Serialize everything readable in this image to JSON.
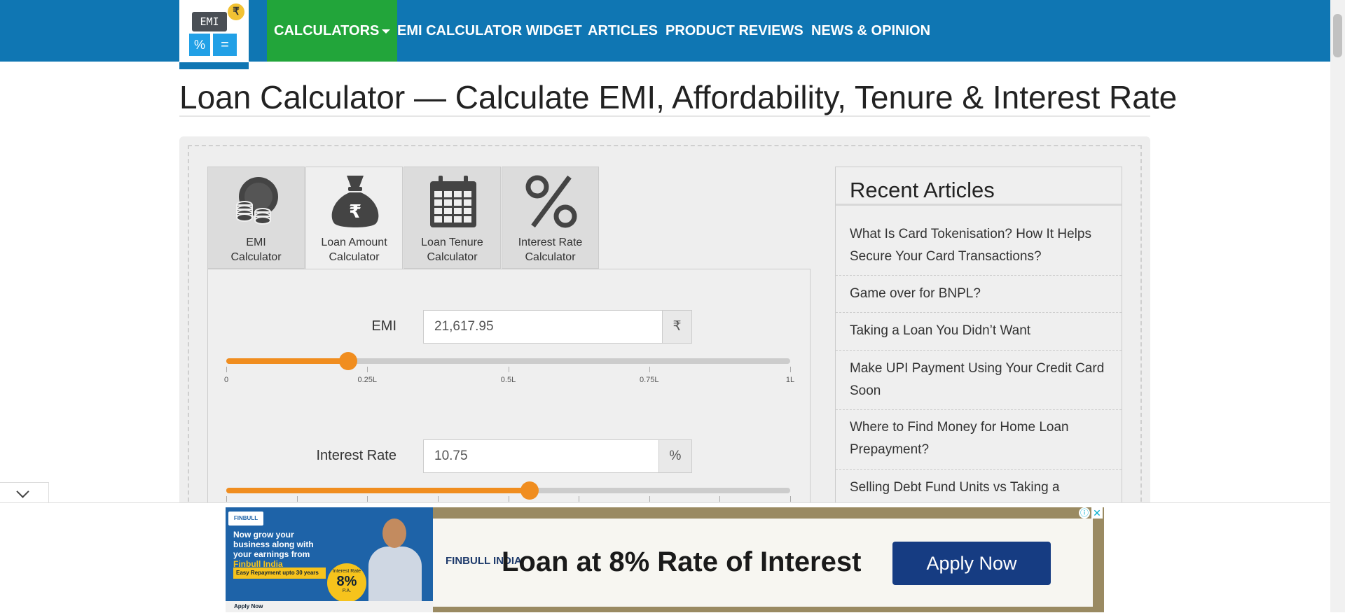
{
  "logo": {
    "emi_text": "EMI",
    "rupee_symbol": "₹",
    "percent_symbol": "%",
    "equals_symbol": "="
  },
  "nav": {
    "calculators": "CALCULATORS",
    "emi_widget": "EMI CALCULATOR WIDGET",
    "articles": "ARTICLES",
    "product_reviews": "PRODUCT REVIEWS",
    "news_opinion": "NEWS & OPINION"
  },
  "page": {
    "title": "Loan Calculator — Calculate EMI, Affordability, Tenure & Interest Rate"
  },
  "tabs": [
    {
      "label_line1": "EMI",
      "label_line2": "Calculator",
      "icon": "coins-icon"
    },
    {
      "label_line1": "Loan Amount",
      "label_line2": "Calculator",
      "icon": "money-bag-icon",
      "active": true
    },
    {
      "label_line1": "Loan Tenure",
      "label_line2": "Calculator",
      "icon": "calendar-icon"
    },
    {
      "label_line1": "Interest Rate",
      "label_line2": "Calculator",
      "icon": "percent-icon"
    }
  ],
  "emi_field": {
    "label": "EMI",
    "value": "21,617.95",
    "unit": "₹",
    "slider_fraction": 0.216,
    "ticks": [
      "0",
      "0.25L",
      "0.5L",
      "0.75L",
      "1L"
    ]
  },
  "interest_field": {
    "label": "Interest Rate",
    "value": "10.75",
    "unit": "%",
    "slider_fraction": 0.5375
  },
  "sidebar": {
    "title": "Recent Articles",
    "articles": [
      "What Is Card Tokenisation? How It Helps Secure Your Card Transactions?",
      "Game over for BNPL?",
      "Taking a Loan You Didn’t Want",
      "Make UPI Payment Using Your Credit Card Soon",
      "Where to Find Money for Home Loan Prepayment?",
      "Selling Debt Fund Units vs Taking a"
    ]
  },
  "ad": {
    "brand_small": "FINBULL INDIA",
    "left_line1": "Now grow your business along with your earnings from ",
    "left_brand": "Finbull India",
    "easy_repayment": "Easy Repayment upto 30 years",
    "badge_top": "Interest Rate",
    "badge_value": "8%",
    "badge_bottom": "P.A.",
    "apply_small": "Apply Now",
    "logo_text": "FINBULL INDIA",
    "headline": "Loan at 8% Rate of Interest",
    "cta": "Apply Now",
    "info_symbol": "ⓘ",
    "close_symbol": "✕"
  },
  "colors": {
    "nav_bg": "#0f76b3",
    "nav_active": "#22a53a",
    "slider": "#f08d1f",
    "ad_cta": "#163c82"
  }
}
